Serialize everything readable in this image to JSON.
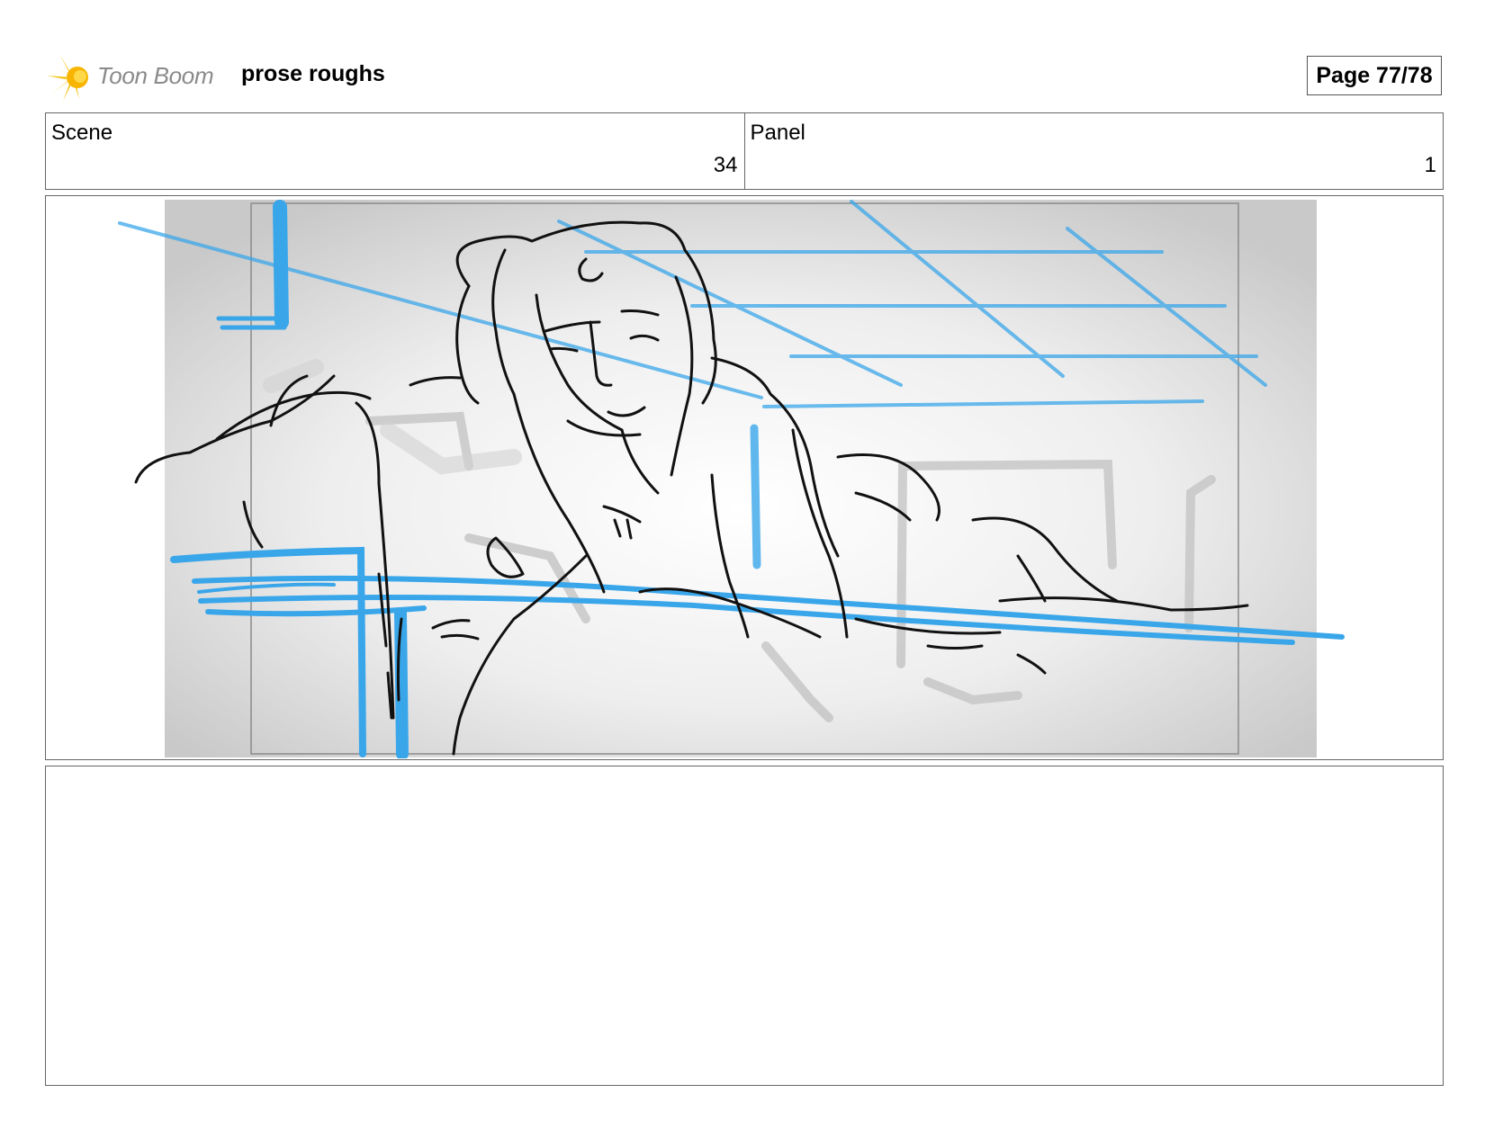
{
  "header": {
    "logo_text": "Toon Boom",
    "project_title": "prose roughs",
    "page_label": "Page 77/78"
  },
  "info": {
    "scene_label": "Scene",
    "scene_value": "34",
    "panel_label": "Panel",
    "panel_value": "1"
  },
  "colors": {
    "sketch_blue": "#3aa6ea",
    "sketch_black": "#111111",
    "logo_yellow": "#f4c20d"
  }
}
